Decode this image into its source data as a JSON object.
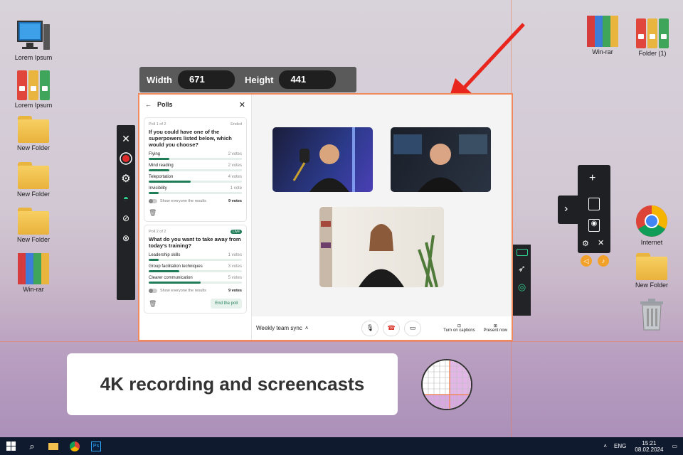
{
  "desktop": {
    "left_icons": [
      {
        "label": "Lorem Ipsum",
        "icon": "computer-icon"
      },
      {
        "label": "Lorem Ipsum",
        "icon": "binders-icon"
      },
      {
        "label": "New Folder",
        "icon": "folder-icon"
      },
      {
        "label": "New Folder",
        "icon": "folder-icon"
      },
      {
        "label": "New Folder",
        "icon": "folder-icon"
      },
      {
        "label": "Win-rar",
        "icon": "winrar-icon"
      }
    ],
    "right_icons": [
      {
        "label": "Win-rar",
        "icon": "winrar-icon"
      },
      {
        "label": "Folder (1)",
        "icon": "binders-icon"
      },
      {
        "label": "Internet",
        "icon": "chrome-icon"
      },
      {
        "label": "New Folder",
        "icon": "folder-icon"
      },
      {
        "label": "",
        "icon": "recycle-bin-icon"
      }
    ]
  },
  "size_bar": {
    "width_label": "Width",
    "width_value": "671",
    "height_label": "Height",
    "height_value": "441"
  },
  "polls_panel": {
    "title": "Polls",
    "poll1": {
      "meta_left": "Poll 1 of 2",
      "meta_right": "Ended",
      "question": "If you could have one of the superpowers listed below, which would you choose?",
      "options": [
        {
          "label": "Flying",
          "votes": "2 votes",
          "fraction": 0.22
        },
        {
          "label": "Mind reading",
          "votes": "2 votes",
          "fraction": 0.22
        },
        {
          "label": "Teleportation",
          "votes": "4 votes",
          "fraction": 0.45
        },
        {
          "label": "Invisibility",
          "votes": "1 vote",
          "fraction": 0.11
        }
      ],
      "toggle_label": "Show everyone the results",
      "total": "9 votes"
    },
    "poll2": {
      "meta_left": "Poll 2 of 2",
      "badge": "Live",
      "question": "What do you want to take away from today's training?",
      "options": [
        {
          "label": "Leadership skills",
          "votes": "1 votes",
          "fraction": 0.11
        },
        {
          "label": "Group facilitation techniques",
          "votes": "3 votes",
          "fraction": 0.33
        },
        {
          "label": "Clearer communication",
          "votes": "5 votes",
          "fraction": 0.56
        }
      ],
      "toggle_label": "Show everyone the results",
      "total": "9 votes",
      "end_button": "End the poll"
    }
  },
  "meeting_bar": {
    "title": "Weekly team sync",
    "captions_label": "Turn on captions",
    "present_label": "Present now"
  },
  "caption_card": {
    "text": "4K recording and screencasts"
  },
  "taskbar": {
    "lang": "ENG",
    "time": "15:21",
    "date": "08.02.2024"
  },
  "colors": {
    "accent_orange": "#f08a5d",
    "poll_green": "#1e7d57",
    "toolbar_dark": "#222326",
    "record_red": "#e02b2b",
    "arrow_red": "#e8261e"
  }
}
